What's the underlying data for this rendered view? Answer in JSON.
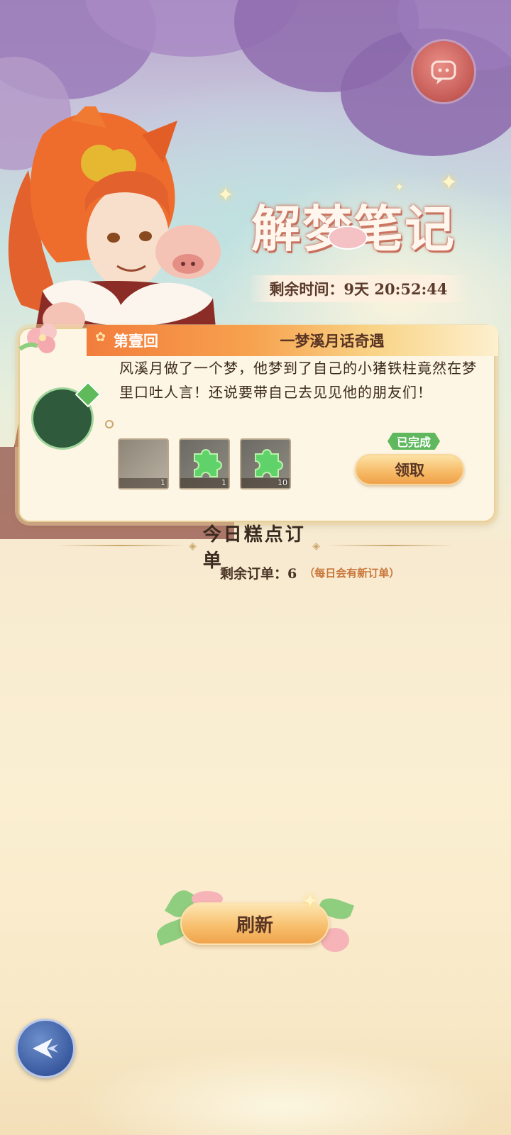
{
  "event": {
    "title": "解梦笔记",
    "timer": "剩余时间：9天 20:52:44"
  },
  "quest": {
    "chapter": "第壹回",
    "chapter_title": "一梦溪月话奇遇",
    "description": "风溪月做了一个梦，他梦到了自己的小猪铁柱竟然在梦里口吐人言！还说要带自己去见见他的朋友们！",
    "rewards": [
      {
        "icon": "gray-item-icon",
        "count": "1"
      },
      {
        "icon": "green-puzzle-icon",
        "count": "1"
      },
      {
        "icon": "green-puzzle-icon",
        "count": "10"
      }
    ],
    "status": "已完成",
    "claim_label": "领取"
  },
  "orders": {
    "title": "今日糕点订单",
    "remaining": "剩余订单：6",
    "note": "（每日会有新订单）"
  },
  "refresh_label": "刷新",
  "colors": {
    "accent_orange": "#f27d3c",
    "button_gold": "#f6b965",
    "status_green": "#5fb85d",
    "back_blue": "#3a5aa0"
  }
}
